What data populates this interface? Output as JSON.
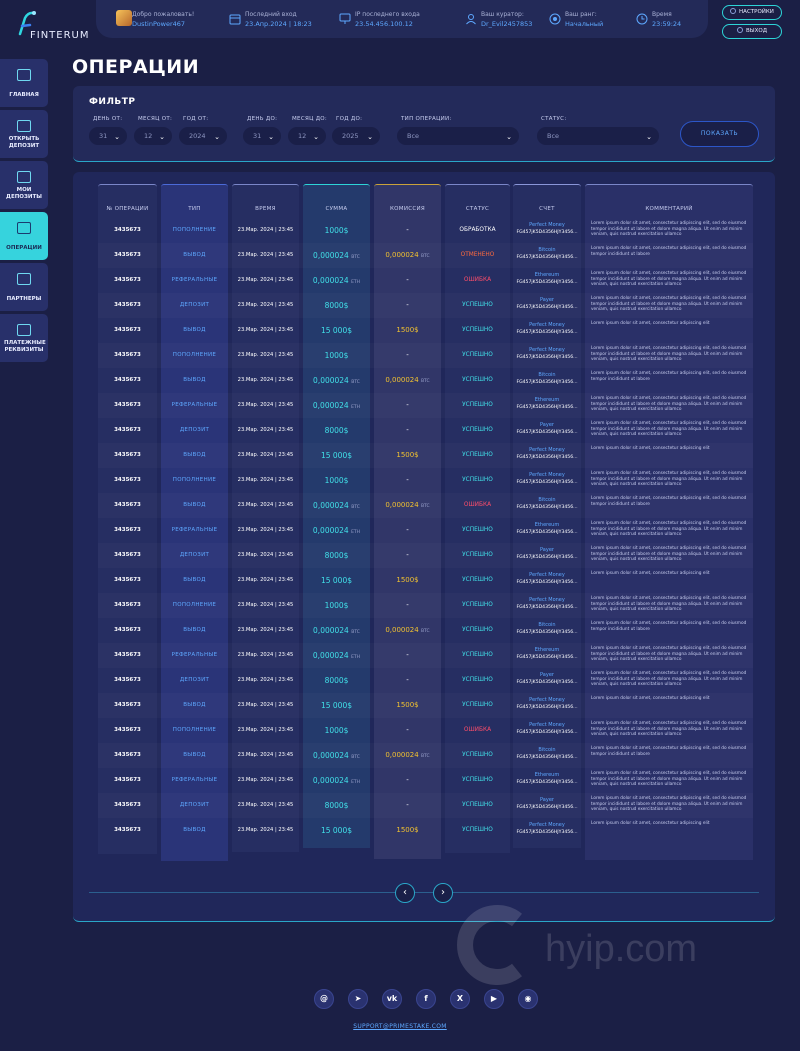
{
  "brand": {
    "name": "FINTERUM"
  },
  "header": {
    "user": {
      "label": "Добро пожаловать!",
      "value": "DustinPower467"
    },
    "last_login": {
      "label": "Последний вход",
      "value": "23.Апр.2024 | 18:23"
    },
    "ip": {
      "label": "IP последнего входа",
      "value": "23.54.456.100.12"
    },
    "curator": {
      "label": "Ваш куратор:",
      "value": "Dr_Evil2457853"
    },
    "rank": {
      "label": "Ваш ранг:",
      "value": "Начальный"
    },
    "time": {
      "label": "Время",
      "value": "23:59:24"
    },
    "settings_label": "НАСТРОЙКИ",
    "logout_label": "ВЫХОД"
  },
  "sidebar": {
    "items": [
      {
        "label": "ГЛАВНАЯ",
        "icon": "home-icon"
      },
      {
        "label": "ОТКРЫТЬ ДЕПОЗИТ",
        "icon": "deposit-icon"
      },
      {
        "label": "МОИ ДЕПОЗИТЫ",
        "icon": "wallet-icon"
      },
      {
        "label": "ОПЕРАЦИИ",
        "icon": "operations-icon",
        "active": true
      },
      {
        "label": "ПАРТНЕРЫ",
        "icon": "partners-icon"
      },
      {
        "label": "ПЛАТЕЖНЫЕ РЕКВИЗИТЫ",
        "icon": "payment-icon"
      }
    ]
  },
  "page": {
    "title": "ОПЕРАЦИИ"
  },
  "filter": {
    "title": "ФИЛЬТР",
    "day_from": {
      "label": "ДЕНЬ ОТ:",
      "value": "31"
    },
    "month_from": {
      "label": "МЕСЯЦ ОТ:",
      "value": "12"
    },
    "year_from": {
      "label": "ГОД ОТ:",
      "value": "2024"
    },
    "day_to": {
      "label": "ДЕНЬ ДО:",
      "value": "31"
    },
    "month_to": {
      "label": "МЕСЯЦ ДО:",
      "value": "12"
    },
    "year_to": {
      "label": "ГОД ДО:",
      "value": "2025"
    },
    "op_type": {
      "label": "ТИП ОПЕРАЦИИ:",
      "value": "Все"
    },
    "status": {
      "label": "СТАТУС:",
      "value": "Все"
    },
    "show_label": "ПОКАЗАТЬ"
  },
  "table": {
    "headers": [
      "№ ОПЕРАЦИИ",
      "ТИП",
      "ВРЕМЯ",
      "СУММА",
      "КОМИССИЯ",
      "СТАТУС",
      "СЧЕТ",
      "КОММЕНТАРИЙ"
    ],
    "rows": [
      {
        "id": "3435673",
        "type": "ПОПОЛНЕНИЕ",
        "time": "23.Мар. 2024 | 23:45",
        "sum": "1000$",
        "sum_unit": "",
        "fee": "-",
        "fee_unit": "",
        "status": "ОБРАБОТКА",
        "system": "Perfect Money",
        "account": "FG457jK5D4356HJY3456...",
        "comment": "Lorem ipsum dolor sit amet, consectetur adipiscing elit, sed do eiusmod tempor incididunt ut labore et dolore magna aliqua. Ut enim ad minim veniam, quis nostrud exercitation ullamco"
      },
      {
        "id": "3435673",
        "type": "ВЫВОД",
        "time": "23.Мар. 2024 | 23:45",
        "sum": "0,000024",
        "sum_unit": "BTC",
        "fee": "0,000024",
        "fee_unit": "BTC",
        "status": "ОТМЕНЕНО",
        "system": "Bitcoin",
        "account": "FG457jK5D4356HJY3456...",
        "comment": "Lorem ipsum dolor sit amet, consectetur adipiscing elit, sed do eiusmod tempor incididunt ut labore"
      },
      {
        "id": "3435673",
        "type": "РЕФЕРАЛЬНЫЕ",
        "time": "23.Мар. 2024 | 23:45",
        "sum": "0,000024",
        "sum_unit": "ETH",
        "fee": "-",
        "fee_unit": "",
        "status": "ОШИБКА",
        "system": "Ethereum",
        "account": "FG457jK5D4356HJY3456...",
        "comment": "Lorem ipsum dolor sit amet, consectetur adipiscing elit, sed do eiusmod tempor incididunt ut labore et dolore magna aliqua. Ut enim ad minim veniam, quis nostrud exercitation ullamco"
      },
      {
        "id": "3435673",
        "type": "ДЕПОЗИТ",
        "time": "23.Мар. 2024 | 23:45",
        "sum": "8000$",
        "sum_unit": "",
        "fee": "-",
        "fee_unit": "",
        "status": "УСПЕШНО",
        "system": "Payer",
        "account": "FG457jK5D4356HJY3456...",
        "comment": "Lorem ipsum dolor sit amet, consectetur adipiscing elit, sed do eiusmod tempor incididunt ut labore et dolore magna aliqua. Ut enim ad minim veniam, quis nostrud exercitation ullamco"
      },
      {
        "id": "3435673",
        "type": "ВЫВОД",
        "time": "23.Мар. 2024 | 23:45",
        "sum": "15 000$",
        "sum_unit": "",
        "fee": "1500$",
        "fee_unit": "",
        "status": "УСПЕШНО",
        "system": "Perfect Money",
        "account": "FG457jK5D4356HJY3456...",
        "comment": "Lorem ipsum dolor sit amet, consectetur adipiscing elit"
      },
      {
        "id": "3435673",
        "type": "ПОПОЛНЕНИЕ",
        "time": "23.Мар. 2024 | 23:45",
        "sum": "1000$",
        "sum_unit": "",
        "fee": "-",
        "fee_unit": "",
        "status": "УСПЕШНО",
        "system": "Perfect Money",
        "account": "FG457jK5D4356HJY3456...",
        "comment": "Lorem ipsum dolor sit amet, consectetur adipiscing elit, sed do eiusmod tempor incididunt ut labore et dolore magna aliqua. Ut enim ad minim veniam, quis nostrud exercitation ullamco"
      },
      {
        "id": "3435673",
        "type": "ВЫВОД",
        "time": "23.Мар. 2024 | 23:45",
        "sum": "0,000024",
        "sum_unit": "BTC",
        "fee": "0,000024",
        "fee_unit": "BTC",
        "status": "УСПЕШНО",
        "system": "Bitcoin",
        "account": "FG457jK5D4356HJY3456...",
        "comment": "Lorem ipsum dolor sit amet, consectetur adipiscing elit, sed do eiusmod tempor incididunt ut labore"
      },
      {
        "id": "3435673",
        "type": "РЕФЕРАЛЬНЫЕ",
        "time": "23.Мар. 2024 | 23:45",
        "sum": "0,000024",
        "sum_unit": "ETH",
        "fee": "-",
        "fee_unit": "",
        "status": "УСПЕШНО",
        "system": "Ethereum",
        "account": "FG457jK5D4356HJY3456...",
        "comment": "Lorem ipsum dolor sit amet, consectetur adipiscing elit, sed do eiusmod tempor incididunt ut labore et dolore magna aliqua. Ut enim ad minim veniam, quis nostrud exercitation ullamco"
      },
      {
        "id": "3435673",
        "type": "ДЕПОЗИТ",
        "time": "23.Мар. 2024 | 23:45",
        "sum": "8000$",
        "sum_unit": "",
        "fee": "-",
        "fee_unit": "",
        "status": "УСПЕШНО",
        "system": "Payer",
        "account": "FG457jK5D4356HJY3456...",
        "comment": "Lorem ipsum dolor sit amet, consectetur adipiscing elit, sed do eiusmod tempor incididunt ut labore et dolore magna aliqua. Ut enim ad minim veniam, quis nostrud exercitation ullamco"
      },
      {
        "id": "3435673",
        "type": "ВЫВОД",
        "time": "23.Мар. 2024 | 23:45",
        "sum": "15 000$",
        "sum_unit": "",
        "fee": "1500$",
        "fee_unit": "",
        "status": "УСПЕШНО",
        "system": "Perfect Money",
        "account": "FG457jK5D4356HJY3456...",
        "comment": "Lorem ipsum dolor sit amet, consectetur adipiscing elit"
      },
      {
        "id": "3435673",
        "type": "ПОПОЛНЕНИЕ",
        "time": "23.Мар. 2024 | 23:45",
        "sum": "1000$",
        "sum_unit": "",
        "fee": "-",
        "fee_unit": "",
        "status": "УСПЕШНО",
        "system": "Perfect Money",
        "account": "FG457jK5D4356HJY3456...",
        "comment": "Lorem ipsum dolor sit amet, consectetur adipiscing elit, sed do eiusmod tempor incididunt ut labore et dolore magna aliqua. Ut enim ad minim veniam, quis nostrud exercitation ullamco"
      },
      {
        "id": "3435673",
        "type": "ВЫВОД",
        "time": "23.Мар. 2024 | 23:45",
        "sum": "0,000024",
        "sum_unit": "BTC",
        "fee": "0,000024",
        "fee_unit": "BTC",
        "status": "ОШИБКА",
        "system": "Bitcoin",
        "account": "FG457jK5D4356HJY3456...",
        "comment": "Lorem ipsum dolor sit amet, consectetur adipiscing elit, sed do eiusmod tempor incididunt ut labore"
      },
      {
        "id": "3435673",
        "type": "РЕФЕРАЛЬНЫЕ",
        "time": "23.Мар. 2024 | 23:45",
        "sum": "0,000024",
        "sum_unit": "ETH",
        "fee": "-",
        "fee_unit": "",
        "status": "УСПЕШНО",
        "system": "Ethereum",
        "account": "FG457jK5D4356HJY3456...",
        "comment": "Lorem ipsum dolor sit amet, consectetur adipiscing elit, sed do eiusmod tempor incididunt ut labore et dolore magna aliqua. Ut enim ad minim veniam, quis nostrud exercitation ullamco"
      },
      {
        "id": "3435673",
        "type": "ДЕПОЗИТ",
        "time": "23.Мар. 2024 | 23:45",
        "sum": "8000$",
        "sum_unit": "",
        "fee": "-",
        "fee_unit": "",
        "status": "УСПЕШНО",
        "system": "Payer",
        "account": "FG457jK5D4356HJY3456...",
        "comment": "Lorem ipsum dolor sit amet, consectetur adipiscing elit, sed do eiusmod tempor incididunt ut labore et dolore magna aliqua. Ut enim ad minim veniam, quis nostrud exercitation ullamco"
      },
      {
        "id": "3435673",
        "type": "ВЫВОД",
        "time": "23.Мар. 2024 | 23:45",
        "sum": "15 000$",
        "sum_unit": "",
        "fee": "1500$",
        "fee_unit": "",
        "status": "УСПЕШНО",
        "system": "Perfect Money",
        "account": "FG457jK5D4356HJY3456...",
        "comment": "Lorem ipsum dolor sit amet, consectetur adipiscing elit"
      },
      {
        "id": "3435673",
        "type": "ПОПОЛНЕНИЕ",
        "time": "23.Мар. 2024 | 23:45",
        "sum": "1000$",
        "sum_unit": "",
        "fee": "-",
        "fee_unit": "",
        "status": "УСПЕШНО",
        "system": "Perfect Money",
        "account": "FG457jK5D4356HJY3456...",
        "comment": "Lorem ipsum dolor sit amet, consectetur adipiscing elit, sed do eiusmod tempor incididunt ut labore et dolore magna aliqua. Ut enim ad minim veniam, quis nostrud exercitation ullamco"
      },
      {
        "id": "3435673",
        "type": "ВЫВОД",
        "time": "23.Мар. 2024 | 23:45",
        "sum": "0,000024",
        "sum_unit": "BTC",
        "fee": "0,000024",
        "fee_unit": "BTC",
        "status": "УСПЕШНО",
        "system": "Bitcoin",
        "account": "FG457jK5D4356HJY3456...",
        "comment": "Lorem ipsum dolor sit amet, consectetur adipiscing elit, sed do eiusmod tempor incididunt ut labore"
      },
      {
        "id": "3435673",
        "type": "РЕФЕРАЛЬНЫЕ",
        "time": "23.Мар. 2024 | 23:45",
        "sum": "0,000024",
        "sum_unit": "ETH",
        "fee": "-",
        "fee_unit": "",
        "status": "УСПЕШНО",
        "system": "Ethereum",
        "account": "FG457jK5D4356HJY3456...",
        "comment": "Lorem ipsum dolor sit amet, consectetur adipiscing elit, sed do eiusmod tempor incididunt ut labore et dolore magna aliqua. Ut enim ad minim veniam, quis nostrud exercitation ullamco"
      },
      {
        "id": "3435673",
        "type": "ДЕПОЗИТ",
        "time": "23.Мар. 2024 | 23:45",
        "sum": "8000$",
        "sum_unit": "",
        "fee": "-",
        "fee_unit": "",
        "status": "УСПЕШНО",
        "system": "Payer",
        "account": "FG457jK5D4356HJY3456...",
        "comment": "Lorem ipsum dolor sit amet, consectetur adipiscing elit, sed do eiusmod tempor incididunt ut labore et dolore magna aliqua. Ut enim ad minim veniam, quis nostrud exercitation ullamco"
      },
      {
        "id": "3435673",
        "type": "ВЫВОД",
        "time": "23.Мар. 2024 | 23:45",
        "sum": "15 000$",
        "sum_unit": "",
        "fee": "1500$",
        "fee_unit": "",
        "status": "УСПЕШНО",
        "system": "Perfect Money",
        "account": "FG457jK5D4356HJY3456...",
        "comment": "Lorem ipsum dolor sit amet, consectetur adipiscing elit"
      },
      {
        "id": "3435673",
        "type": "ПОПОЛНЕНИЕ",
        "time": "23.Мар. 2024 | 23:45",
        "sum": "1000$",
        "sum_unit": "",
        "fee": "-",
        "fee_unit": "",
        "status": "ОШИБКА",
        "system": "Perfect Money",
        "account": "FG457jK5D4356HJY3456...",
        "comment": "Lorem ipsum dolor sit amet, consectetur adipiscing elit, sed do eiusmod tempor incididunt ut labore et dolore magna aliqua. Ut enim ad minim veniam, quis nostrud exercitation ullamco"
      },
      {
        "id": "3435673",
        "type": "ВЫВОД",
        "time": "23.Мар. 2024 | 23:45",
        "sum": "0,000024",
        "sum_unit": "BTC",
        "fee": "0,000024",
        "fee_unit": "BTC",
        "status": "УСПЕШНО",
        "system": "Bitcoin",
        "account": "FG457jK5D4356HJY3456...",
        "comment": "Lorem ipsum dolor sit amet, consectetur adipiscing elit, sed do eiusmod tempor incididunt ut labore"
      },
      {
        "id": "3435673",
        "type": "РЕФЕРАЛЬНЫЕ",
        "time": "23.Мар. 2024 | 23:45",
        "sum": "0,000024",
        "sum_unit": "ETH",
        "fee": "-",
        "fee_unit": "",
        "status": "УСПЕШНО",
        "system": "Ethereum",
        "account": "FG457jK5D4356HJY3456...",
        "comment": "Lorem ipsum dolor sit amet, consectetur adipiscing elit, sed do eiusmod tempor incididunt ut labore et dolore magna aliqua. Ut enim ad minim veniam, quis nostrud exercitation ullamco"
      },
      {
        "id": "3435673",
        "type": "ДЕПОЗИТ",
        "time": "23.Мар. 2024 | 23:45",
        "sum": "8000$",
        "sum_unit": "",
        "fee": "-",
        "fee_unit": "",
        "status": "УСПЕШНО",
        "system": "Payer",
        "account": "FG457jK5D4356HJY3456...",
        "comment": "Lorem ipsum dolor sit amet, consectetur adipiscing elit, sed do eiusmod tempor incididunt ut labore et dolore magna aliqua. Ut enim ad minim veniam, quis nostrud exercitation ullamco"
      },
      {
        "id": "3435673",
        "type": "ВЫВОД",
        "time": "23.Мар. 2024 | 23:45",
        "sum": "15 000$",
        "sum_unit": "",
        "fee": "1500$",
        "fee_unit": "",
        "status": "УСПЕШНО",
        "system": "Perfect Money",
        "account": "FG457jK5D4356HJY3456...",
        "comment": "Lorem ipsum dolor sit amet, consectetur adipiscing elit"
      }
    ]
  },
  "pagination": {
    "prev_icon": "chevron-left-icon",
    "next_icon": "chevron-right-icon"
  },
  "status_colors": {
    "ОБРАБОТКА": "#ffffff",
    "ОТМЕНЕНО": "#ff6a3d",
    "ОШИБКА": "#ff4d6a",
    "УСПЕШНО": "#41e0e8"
  },
  "watermark": {
    "text": "hyip.com"
  },
  "footer": {
    "socials": [
      {
        "glyph": "@",
        "icon": "email-icon"
      },
      {
        "glyph": "➤",
        "icon": "telegram-icon"
      },
      {
        "glyph": "vk",
        "icon": "vk-icon"
      },
      {
        "glyph": "f",
        "icon": "facebook-icon"
      },
      {
        "glyph": "X",
        "icon": "x-icon"
      },
      {
        "glyph": "▶",
        "icon": "youtube-icon"
      },
      {
        "glyph": "◉",
        "icon": "discord-icon"
      }
    ],
    "support_email": "SUPPORT@PRIMESTAKE.COM"
  }
}
